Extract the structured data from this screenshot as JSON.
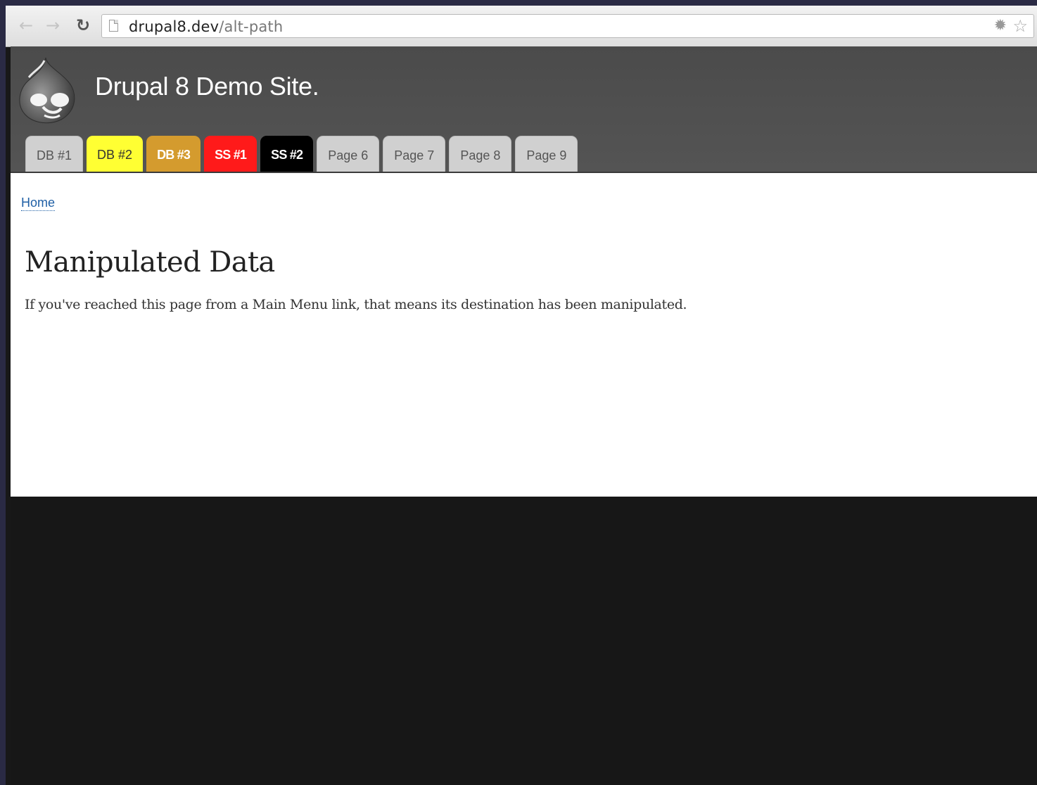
{
  "browser": {
    "url_host": "drupal8.dev",
    "url_path": "/alt-path",
    "back_icon": "back-arrow-icon",
    "forward_icon": "forward-arrow-icon",
    "reload_icon": "reload-icon"
  },
  "site": {
    "name": "Drupal 8 Demo Site.",
    "logo": "drupal-drop-logo"
  },
  "menu": {
    "tabs": [
      {
        "label": "DB #1",
        "bg": "#d0d0d0",
        "color": "#555555"
      },
      {
        "label": "DB #2",
        "bg": "#ffff33",
        "color": "#333333"
      },
      {
        "label": "DB #3",
        "bg": "#d49b2e",
        "color": "#ffffff"
      },
      {
        "label": "SS #1",
        "bg": "#ff1a1a",
        "color": "#ffffff"
      },
      {
        "label": "SS #2",
        "bg": "#000000",
        "color": "#ffffff"
      },
      {
        "label": "Page 6",
        "bg": "#d0d0d0",
        "color": "#555555"
      },
      {
        "label": "Page 7",
        "bg": "#d0d0d0",
        "color": "#555555"
      },
      {
        "label": "Page 8",
        "bg": "#d0d0d0",
        "color": "#555555"
      },
      {
        "label": "Page 9",
        "bg": "#d0d0d0",
        "color": "#555555"
      }
    ]
  },
  "breadcrumb": {
    "home": "Home"
  },
  "content": {
    "title": "Manipulated Data",
    "body": "If you've reached this page from a Main Menu link, that means its destination has been manipulated."
  }
}
